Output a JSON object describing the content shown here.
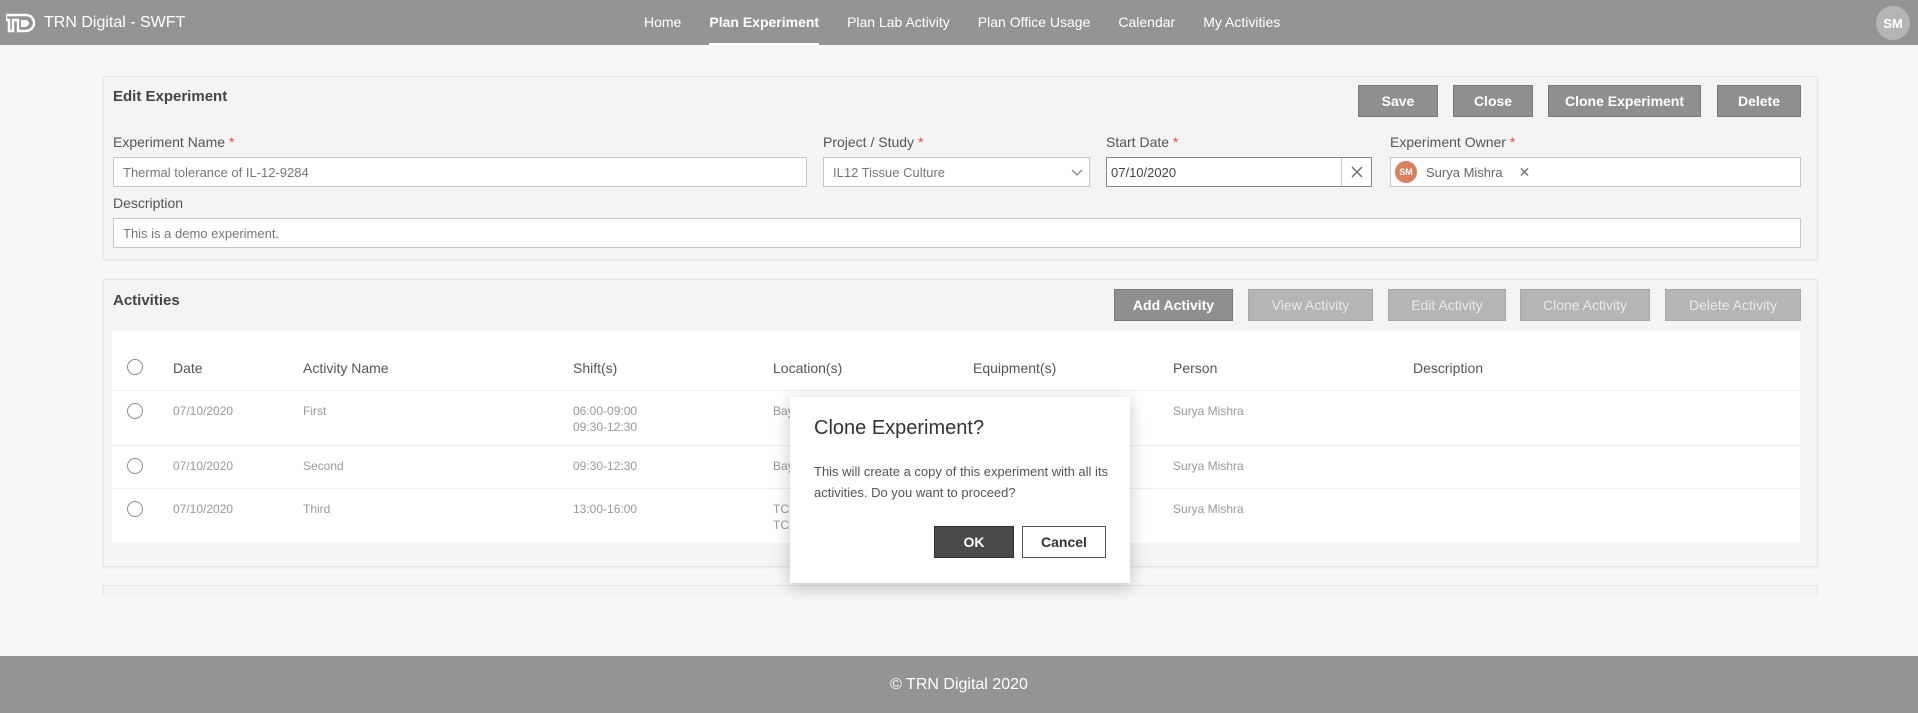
{
  "brand": {
    "title": "TRN Digital - SWFT"
  },
  "nav": {
    "items": [
      {
        "label": "Home"
      },
      {
        "label": "Plan Experiment",
        "active": true
      },
      {
        "label": "Plan Lab Activity"
      },
      {
        "label": "Plan Office Usage"
      },
      {
        "label": "Calendar"
      },
      {
        "label": "My Activities"
      }
    ]
  },
  "user": {
    "initials": "SM"
  },
  "edit": {
    "title": "Edit Experiment",
    "buttons": {
      "save": "Save",
      "close": "Close",
      "clone": "Clone Experiment",
      "delete": "Delete"
    },
    "fields": {
      "name_label": "Experiment Name",
      "name_value": "Thermal tolerance of IL-12-9284",
      "project_label": "Project / Study",
      "project_value": "IL12 Tissue Culture",
      "start_label": "Start Date",
      "start_value": "07/10/2020",
      "owner_label": "Experiment Owner",
      "owner_initials": "SM",
      "owner_name": "Surya Mishra",
      "desc_label": "Description",
      "desc_value": "This is a demo experiment.",
      "required_mark": "*"
    }
  },
  "activities": {
    "title": "Activities",
    "buttons": {
      "add": "Add Activity",
      "view": "View Activity",
      "edit": "Edit Activity",
      "clone": "Clone Activity",
      "delete": "Delete Activity"
    },
    "columns": [
      "Date",
      "Activity Name",
      "Shift(s)",
      "Location(s)",
      "Equipment(s)",
      "Person",
      "Description"
    ],
    "rows": [
      {
        "date": "07/10/2020",
        "name": "First",
        "shift1": "06:00-09:00",
        "shift2": "09:30-12:30",
        "loc1": "Bay",
        "loc2": "",
        "person": "Surya Mishra"
      },
      {
        "date": "07/10/2020",
        "name": "Second",
        "shift1": "09:30-12:30",
        "shift2": "",
        "loc1": "Bay",
        "loc2": "",
        "person": "Surya Mishra"
      },
      {
        "date": "07/10/2020",
        "name": "Third",
        "shift1": "13:00-16:00",
        "shift2": "",
        "loc1": "TC1",
        "loc2": "TC2",
        "person": "Surya Mishra"
      }
    ]
  },
  "modal": {
    "title": "Clone Experiment?",
    "message": "This will create a copy of this experiment with all its activities. Do you want to proceed?",
    "ok": "OK",
    "cancel": "Cancel"
  },
  "footer": {
    "text": "© TRN Digital 2020"
  }
}
